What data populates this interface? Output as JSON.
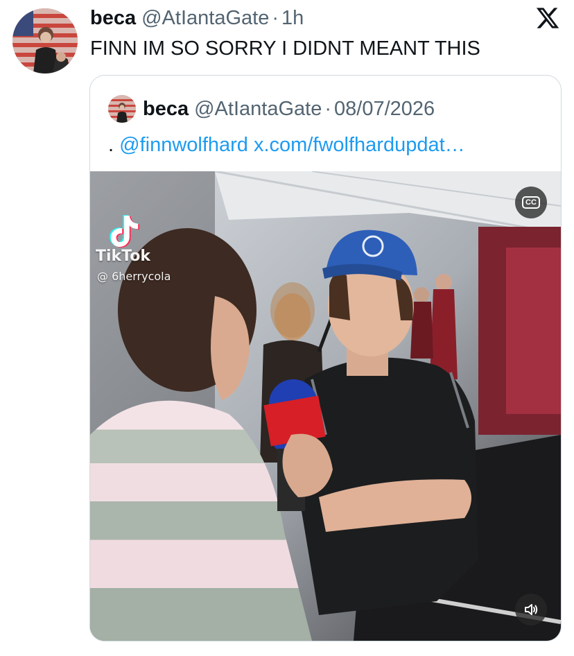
{
  "tweet": {
    "author": {
      "display_name": "beca",
      "handle": "@AtIantaGate",
      "separator": "·",
      "time": "1h"
    },
    "text": "FINN IM SO SORRY I DIDNT MEANT THIS",
    "platform_icon": "x-logo-icon"
  },
  "quoted_tweet": {
    "author": {
      "display_name": "beca",
      "handle": "@AtIantaGate",
      "separator": "·",
      "date": "08/07/2026"
    },
    "text_prefix": ".",
    "mention": "@finnwolfhard",
    "link": "x.com/fwolfhardupdat…",
    "media": {
      "type": "video",
      "watermark_brand": "TikTok",
      "watermark_user": "@ 6herrycola",
      "cc_label": "CC",
      "controls": [
        "cc-icon",
        "volume-icon"
      ]
    }
  },
  "colors": {
    "link": "#1d9bf0",
    "secondary_text": "#536471",
    "border": "#cfd9de"
  }
}
